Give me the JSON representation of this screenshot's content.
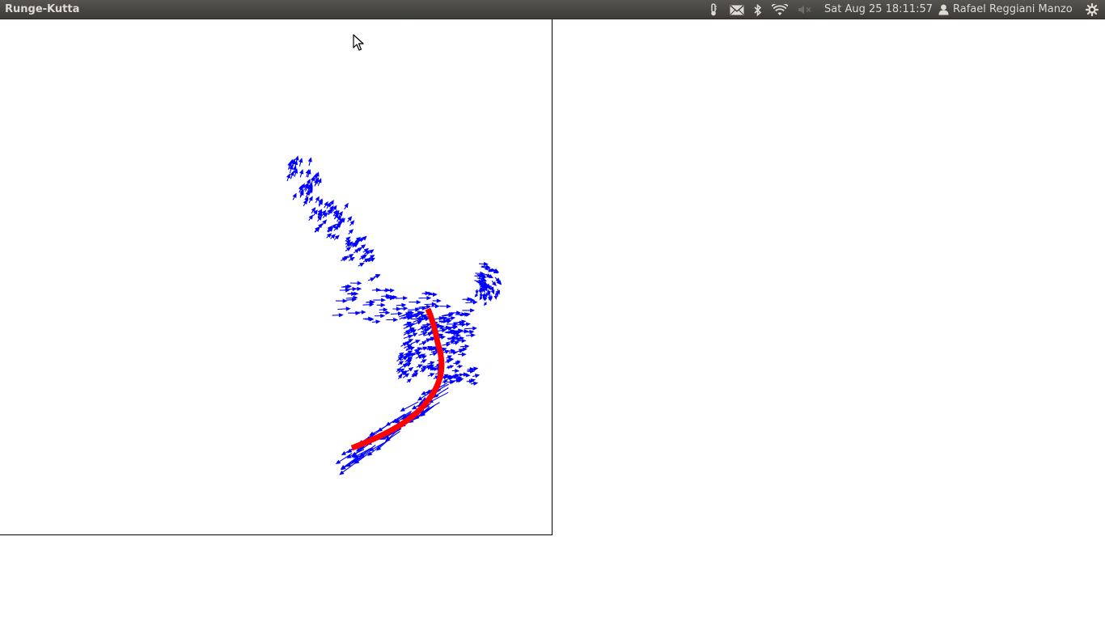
{
  "topbar": {
    "app_title": "Runge-Kutta",
    "clock": "Sat Aug 25 18:11:57",
    "user_name": "Rafael Reggiani Manzo"
  },
  "tray_icons": [
    "thermometer-icon",
    "mail-icon",
    "bluetooth-icon",
    "wifi-icon",
    "volume-muted-icon",
    "user-icon",
    "power-gear-icon"
  ],
  "colors": {
    "vector_field": "#0000ff",
    "trajectory": "#ff0000",
    "topbar_bg": "#3c3b37",
    "topbar_text": "#dfdbd2"
  },
  "window": {
    "content": "vector-field-plot"
  }
}
